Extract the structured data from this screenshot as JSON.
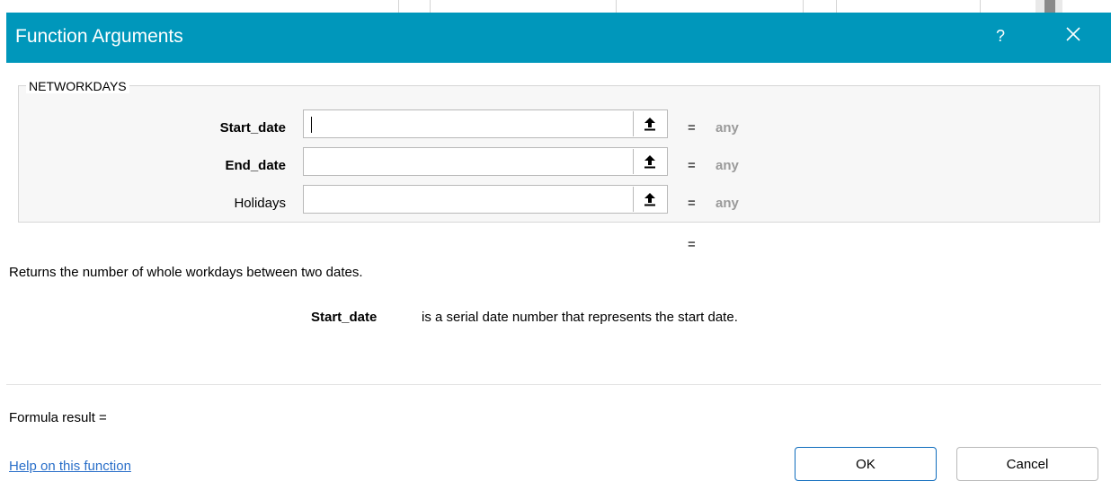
{
  "dialog": {
    "title": "Function Arguments",
    "help_glyph": "?",
    "close_glyph": "✕",
    "titlebar_color": "#0097bb"
  },
  "function_group": {
    "name": "NETWORKDAYS",
    "arguments": [
      {
        "label": "Start_date",
        "required": true,
        "value": "",
        "result": "any",
        "equals": "="
      },
      {
        "label": "End_date",
        "required": true,
        "value": "",
        "result": "any",
        "equals": "="
      },
      {
        "label": "Holidays",
        "required": false,
        "value": "",
        "result": "any",
        "equals": "="
      }
    ],
    "collapse_icon": "upload-arrow-icon"
  },
  "function_result_equals": "=",
  "description": "Returns the number of whole workdays between two dates.",
  "param_help": {
    "name": "Start_date",
    "text": "is a serial date number that represents the start date."
  },
  "formula_result": {
    "label": "Formula result ="
  },
  "links": {
    "help": "Help on this function"
  },
  "buttons": {
    "ok": "OK",
    "cancel": "Cancel"
  }
}
